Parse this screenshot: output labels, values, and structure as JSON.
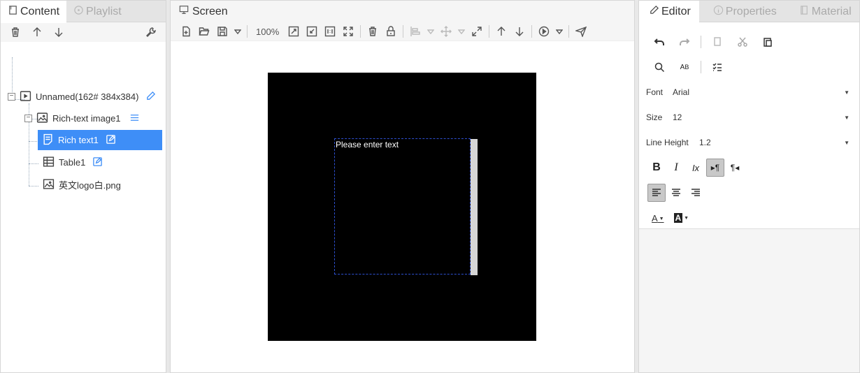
{
  "left": {
    "tabs": [
      {
        "label": "Content"
      },
      {
        "label": "Playlist"
      }
    ],
    "tree": {
      "root": {
        "label": "Unnamed(162# 384x384)"
      },
      "group": {
        "label": "Rich-text image1"
      },
      "items": [
        {
          "label": "Rich text1"
        },
        {
          "label": "Table1"
        },
        {
          "label": "英文logo白.png"
        }
      ]
    }
  },
  "center": {
    "title": "Screen",
    "zoom": "100%",
    "canvas": {
      "rich_text_placeholder": "Please enter text",
      "background": "#000000"
    }
  },
  "right": {
    "tabs": [
      {
        "label": "Editor"
      },
      {
        "label": "Properties"
      },
      {
        "label": "Material"
      }
    ],
    "font": {
      "label": "Font",
      "value": "Arial"
    },
    "size": {
      "label": "Size",
      "value": "12"
    },
    "line_height": {
      "label": "Line Height",
      "value": "1.2"
    },
    "format": {
      "bold": "B",
      "italic": "I",
      "clear": "Ix",
      "ltr": "▸¶",
      "rtl": "¶◂",
      "font_color": "A",
      "bg_color": "A"
    }
  },
  "colors": {
    "accent": "#3e8ef7",
    "selected_row": "#3e8ef7"
  }
}
